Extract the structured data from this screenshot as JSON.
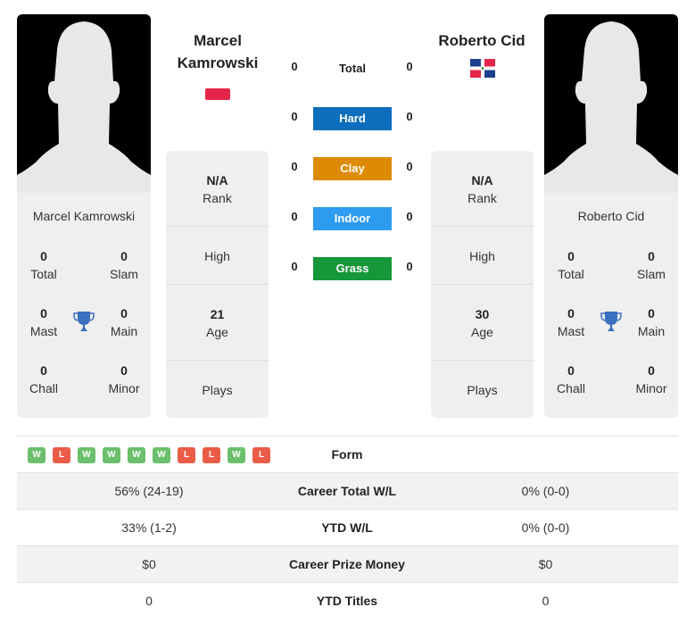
{
  "player1": {
    "name": "Marcel Kamrowski",
    "name_line1": "Marcel",
    "name_line2": "Kamrowski",
    "flag": "poland-flag",
    "stats": {
      "total": "0",
      "total_label": "Total",
      "slam": "0",
      "slam_label": "Slam",
      "mast": "0",
      "mast_label": "Mast",
      "main": "0",
      "main_label": "Main",
      "chall": "0",
      "chall_label": "Chall",
      "minor": "0",
      "minor_label": "Minor"
    },
    "info": {
      "rank_value": "N/A",
      "rank_label": "Rank",
      "high_label": "High",
      "age_value": "21",
      "age_label": "Age",
      "plays_label": "Plays"
    }
  },
  "player2": {
    "name": "Roberto Cid",
    "flag": "dominican-republic-flag",
    "stats": {
      "total": "0",
      "total_label": "Total",
      "slam": "0",
      "slam_label": "Slam",
      "mast": "0",
      "mast_label": "Mast",
      "main": "0",
      "main_label": "Main",
      "chall": "0",
      "chall_label": "Chall",
      "minor": "0",
      "minor_label": "Minor"
    },
    "info": {
      "rank_value": "N/A",
      "rank_label": "Rank",
      "high_label": "High",
      "age_value": "30",
      "age_label": "Age",
      "plays_label": "Plays"
    }
  },
  "h2h": {
    "total": {
      "label": "Total",
      "p1": "0",
      "p2": "0"
    },
    "surfaces": [
      {
        "label": "Hard",
        "p1": "0",
        "p2": "0",
        "color": "#0d6ebd"
      },
      {
        "label": "Clay",
        "p1": "0",
        "p2": "0",
        "color": "#dd8b05"
      },
      {
        "label": "Indoor",
        "p1": "0",
        "p2": "0",
        "color": "#2d9bf0"
      },
      {
        "label": "Grass",
        "p1": "0",
        "p2": "0",
        "color": "#16973a"
      }
    ]
  },
  "comparison": {
    "form_label": "Form",
    "form": [
      "W",
      "L",
      "W",
      "W",
      "W",
      "W",
      "L",
      "L",
      "W",
      "L"
    ],
    "rows": [
      {
        "label": "Career Total W/L",
        "p1": "56% (24-19)",
        "p2": "0% (0-0)"
      },
      {
        "label": "YTD W/L",
        "p1": "33% (1-2)",
        "p2": "0% (0-0)"
      },
      {
        "label": "Career Prize Money",
        "p1": "$0",
        "p2": "$0"
      },
      {
        "label": "YTD Titles",
        "p1": "0",
        "p2": "0"
      }
    ]
  },
  "colors": {
    "win": "#6cbf6c",
    "loss": "#ea5c47",
    "trophy": "#3b6fbf"
  }
}
